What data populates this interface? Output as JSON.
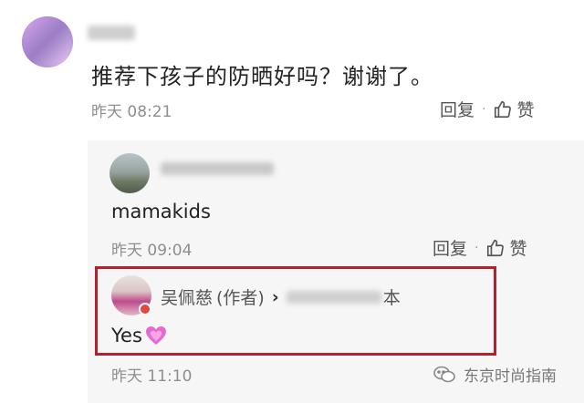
{
  "comment": {
    "username_blurred": "",
    "text": "推荐下孩子的防晒好吗？谢谢了。",
    "time": "昨天 08:21",
    "reply_label": "回复",
    "dot": "·",
    "like_label": "赞"
  },
  "replies": [
    {
      "username_blurred": "user",
      "text": "mamakids",
      "time": "昨天 09:04",
      "reply_label": "回复",
      "dot": "·",
      "like_label": "赞"
    },
    {
      "author_name": "吴佩慈",
      "author_tag": "(作者)",
      "arrow": "›",
      "reply_to_suffix": "本",
      "text": "Yes",
      "emoji": "💓",
      "time": "昨天 11:10",
      "highlight_color": "#b3222c"
    }
  ],
  "watermark": {
    "text": "东京时尚指南"
  },
  "colors": {
    "accent": "#b3222c",
    "meta": "#8e8e8e",
    "reply_bg": "#f6f6f6"
  }
}
